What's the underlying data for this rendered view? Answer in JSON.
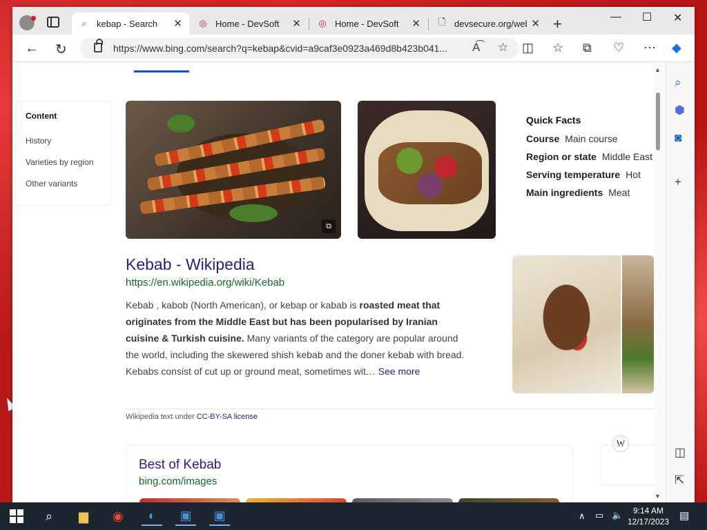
{
  "tabs": [
    {
      "label": "kebap - Search",
      "icon": "search-icon",
      "active": true
    },
    {
      "label": "Home - DevSoft",
      "icon": "devsoft-icon",
      "active": false
    },
    {
      "label": "Home - DevSoft",
      "icon": "devsoft-icon",
      "active": false
    },
    {
      "label": "devsecure.org/web-",
      "icon": "page-icon",
      "active": false
    }
  ],
  "address_bar": {
    "url": "https://www.bing.com/search?q=kebap&cvid=a9caf3e0923a469d8b423b041..."
  },
  "toc": {
    "title": "Content",
    "items": [
      "History",
      "Varieties by region",
      "Other variants"
    ]
  },
  "quick_facts": {
    "title": "Quick Facts",
    "rows": [
      {
        "label": "Course",
        "value": "Main course"
      },
      {
        "label": "Region or state",
        "value": "Middle East"
      },
      {
        "label": "Serving temperature",
        "value": "Hot"
      },
      {
        "label": "Main ingredients",
        "value": "Meat"
      }
    ]
  },
  "result": {
    "title": "Kebab - Wikipedia",
    "url": "https://en.wikipedia.org/wiki/Kebab",
    "snippet_pre": "Kebab , kabob (North American), or kebap or kabab is ",
    "snippet_bold": "roasted meat that originates from the Middle East but has been popularised by Iranian cuisine & Turkish cuisine.",
    "snippet_post": " Many variants of the category are popular around the world, including the skewered shish kebab and the doner kebab with bread. Kebabs consist of cut up or ground meat, sometimes wit…",
    "see_more": "See more"
  },
  "license": {
    "prefix": "Wikipedia text under ",
    "link": "CC-BY-SA license"
  },
  "wiki_badge": "W",
  "images_card": {
    "title": "Best of Kebab",
    "url": "bing.com/images"
  },
  "taskbar": {
    "time": "9:14 AM",
    "date": "12/17/2023"
  },
  "colors": {
    "link": "#2a1b87",
    "url_green": "#116a28",
    "accent": "#174ae4"
  }
}
